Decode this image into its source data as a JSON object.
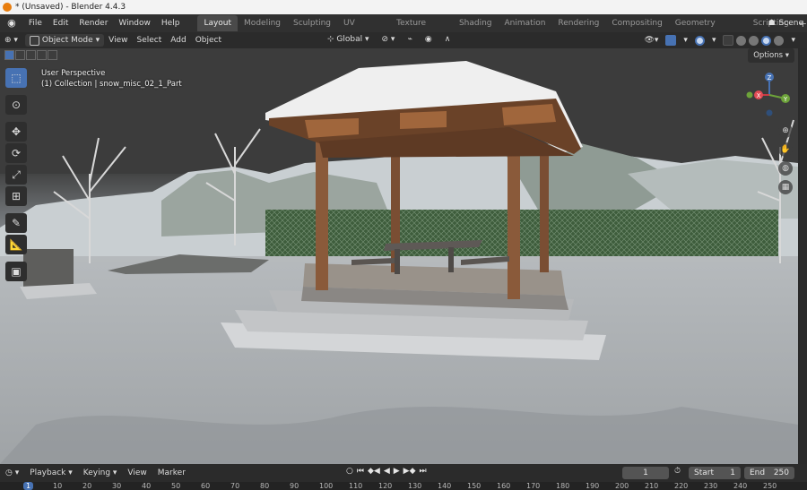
{
  "window": {
    "title": "* (Unsaved) - Blender 4.4.3"
  },
  "menu": [
    "File",
    "Edit",
    "Render",
    "Window",
    "Help"
  ],
  "workspaces": [
    "Layout",
    "Modeling",
    "Sculpting",
    "UV Editing",
    "Texture Paint",
    "Shading",
    "Animation",
    "Rendering",
    "Compositing",
    "Geometry Nodes",
    "Scripting"
  ],
  "active_workspace": "Layout",
  "scene": {
    "label": "Scene"
  },
  "viewport_header": {
    "mode": "Object Mode",
    "menus": [
      "View",
      "Select",
      "Add",
      "Object"
    ],
    "transform_orientation": "Global",
    "options_label": "Options"
  },
  "viewport": {
    "perspective_label": "User Perspective",
    "collection_label": "(1) Collection | snow_misc_02_1_Part"
  },
  "gizmo": {
    "x": "X",
    "y": "Y",
    "z": "Z"
  },
  "tools": [
    "select-box",
    "cursor",
    "move",
    "rotate",
    "scale",
    "transform",
    "annotate",
    "measure",
    "add-cube"
  ],
  "timeline": {
    "menus": [
      "Playback",
      "Keying",
      "View",
      "Marker"
    ],
    "current_frame": "1",
    "start_label": "Start",
    "start_value": "1",
    "end_label": "End",
    "end_value": "250",
    "ruler_ticks": [
      "1",
      "10",
      "20",
      "30",
      "40",
      "50",
      "60",
      "70",
      "80",
      "90",
      "100",
      "110",
      "120",
      "130",
      "140",
      "150",
      "160",
      "170",
      "180",
      "190",
      "200",
      "210",
      "220",
      "230",
      "240",
      "250"
    ]
  },
  "colors": {
    "accent": "#4772b3",
    "header": "#303030",
    "logo": "#e87d0d"
  }
}
